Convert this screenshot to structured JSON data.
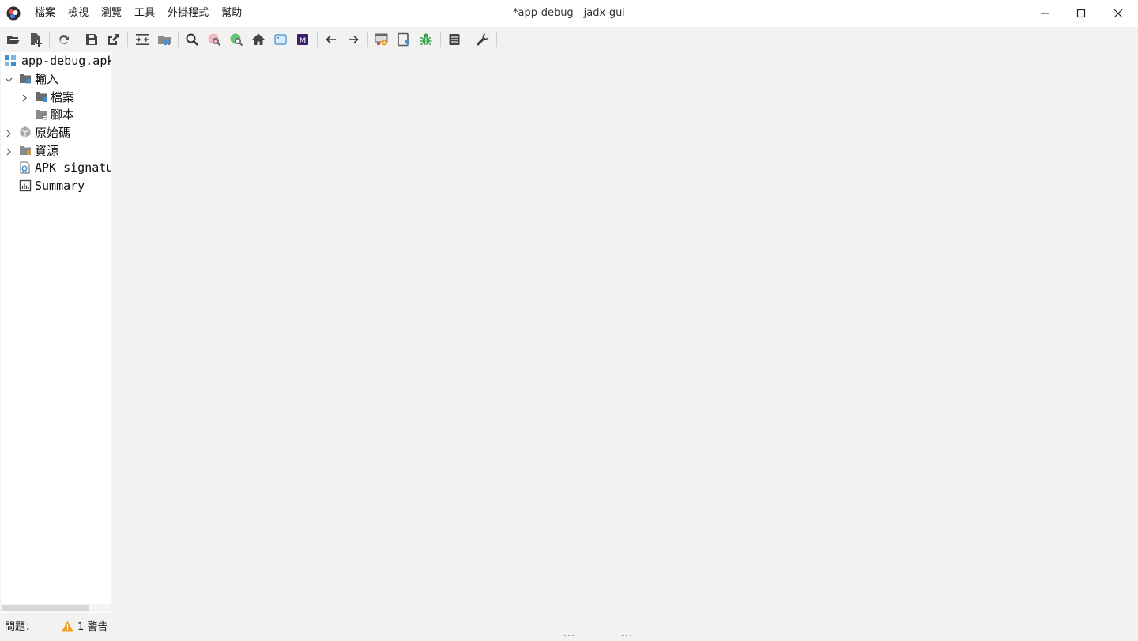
{
  "window": {
    "title": "*app-debug - jadx-gui",
    "controls": [
      "minimize-icon",
      "maximize-icon",
      "close-icon"
    ]
  },
  "menu": {
    "items": [
      "檔案",
      "檢視",
      "瀏覽",
      "工具",
      "外掛程式",
      "幫助"
    ]
  },
  "toolbar": {
    "buttons": [
      "open-file-icon",
      "add-files-icon",
      "reload-icon",
      "save-icon",
      "export-icon",
      "sync-with-editor-icon",
      "flatten-packages-icon",
      "search-icon",
      "usage-search-icon",
      "class-search-icon",
      "home-icon",
      "quick-view-icon",
      "smali-icon",
      "back-arrow-icon",
      "forward-arrow-icon",
      "decompile-all-icon",
      "device-icon",
      "debug-bug-icon",
      "log-icon",
      "preferences-wrench-icon"
    ]
  },
  "tree": {
    "root": "app-debug.apk",
    "inputs": "輸入",
    "files": "檔案",
    "scripts": "腳本",
    "source": "原始碼",
    "resources": "資源",
    "apk_signature": "APK signature",
    "summary": "Summary"
  },
  "status": {
    "issues_label": "問題：",
    "warnings": "1 警告"
  },
  "colors": {
    "folder": "#6b6b6b",
    "accent_blue": "#3d8fd1",
    "bug_green": "#3aa34a",
    "warning_orange": "#f0a020",
    "smali_purple": "#3b1f6e"
  }
}
